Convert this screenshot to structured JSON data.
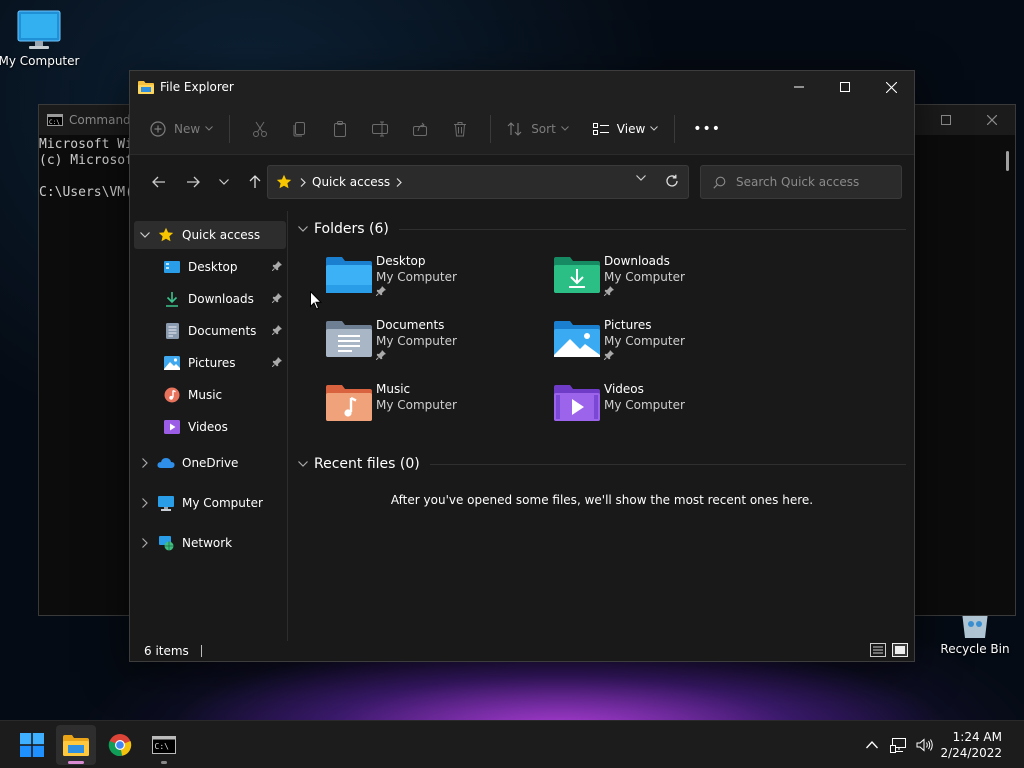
{
  "desktop": {
    "icons": [
      {
        "label": "My Computer"
      },
      {
        "label": "Recycle Bin"
      }
    ]
  },
  "cmd": {
    "title": "Command P",
    "lines": [
      "Microsoft Wi",
      "(c) Microsof",
      "",
      "C:\\Users\\VM("
    ]
  },
  "explorer": {
    "title": "File Explorer",
    "toolbar": {
      "new_label": "New",
      "sort_label": "Sort",
      "view_label": "View",
      "more_label": "•••"
    },
    "address": {
      "crumb": "Quick access"
    },
    "search": {
      "placeholder": "Search Quick access"
    },
    "sidebar": {
      "quick_access": "Quick access",
      "children": [
        {
          "label": "Desktop"
        },
        {
          "label": "Downloads"
        },
        {
          "label": "Documents"
        },
        {
          "label": "Pictures"
        },
        {
          "label": "Music"
        },
        {
          "label": "Videos"
        }
      ],
      "onedrive": "OneDrive",
      "my_computer": "My Computer",
      "network": "Network"
    },
    "folders_header": "Folders (6)",
    "folders": [
      {
        "name": "Desktop",
        "location": "My Computer"
      },
      {
        "name": "Downloads",
        "location": "My Computer"
      },
      {
        "name": "Documents",
        "location": "My Computer"
      },
      {
        "name": "Pictures",
        "location": "My Computer"
      },
      {
        "name": "Music",
        "location": "My Computer"
      },
      {
        "name": "Videos",
        "location": "My Computer"
      }
    ],
    "recent_header": "Recent files (0)",
    "recent_empty": "After you've opened some files, we'll show the most recent ones here.",
    "status": "6 items"
  },
  "taskbar": {
    "time": "1:24 AM",
    "date": "2/24/2022",
    "colors": {
      "accent": "#0078d4",
      "active_indicator": "#d98cd3"
    }
  }
}
